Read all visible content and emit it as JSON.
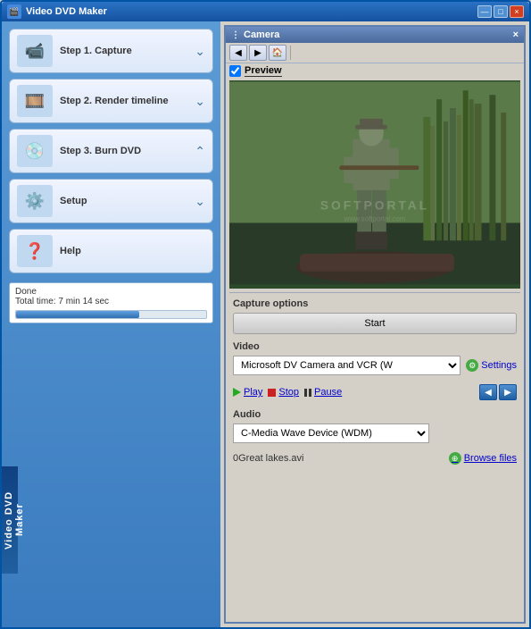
{
  "window": {
    "title": "Video DVD Maker",
    "close_label": "×",
    "max_label": "□",
    "min_label": "—"
  },
  "sidebar": {
    "step1_label": "Step 1. Capture",
    "step2_label": "Step 2. Render timeline",
    "step3_label": "Step 3. Burn DVD",
    "setup_label": "Setup",
    "help_label": "Help",
    "vertical_label": "Video DVD Maker",
    "status_line1": "Done",
    "status_line2": "Total time: 7 min 14 sec"
  },
  "camera": {
    "title": "Camera",
    "close_label": "×",
    "preview_label": "Preview",
    "watermark": "SOFTPORTAL",
    "watermark_url": "www.softportal.com"
  },
  "capture": {
    "section_title": "Capture options",
    "start_label": "Start"
  },
  "video": {
    "section_title": "Video",
    "device_value": "Microsoft DV Camera and VCR (W",
    "settings_label": "Settings"
  },
  "transport": {
    "play_label": "Play",
    "stop_label": "Stop",
    "pause_label": "Pause"
  },
  "audio": {
    "section_title": "Audio",
    "device_value": "C-Media Wave Device (WDM)"
  },
  "file": {
    "filename": "0Great lakes.avi",
    "browse_label": "Browse files"
  }
}
